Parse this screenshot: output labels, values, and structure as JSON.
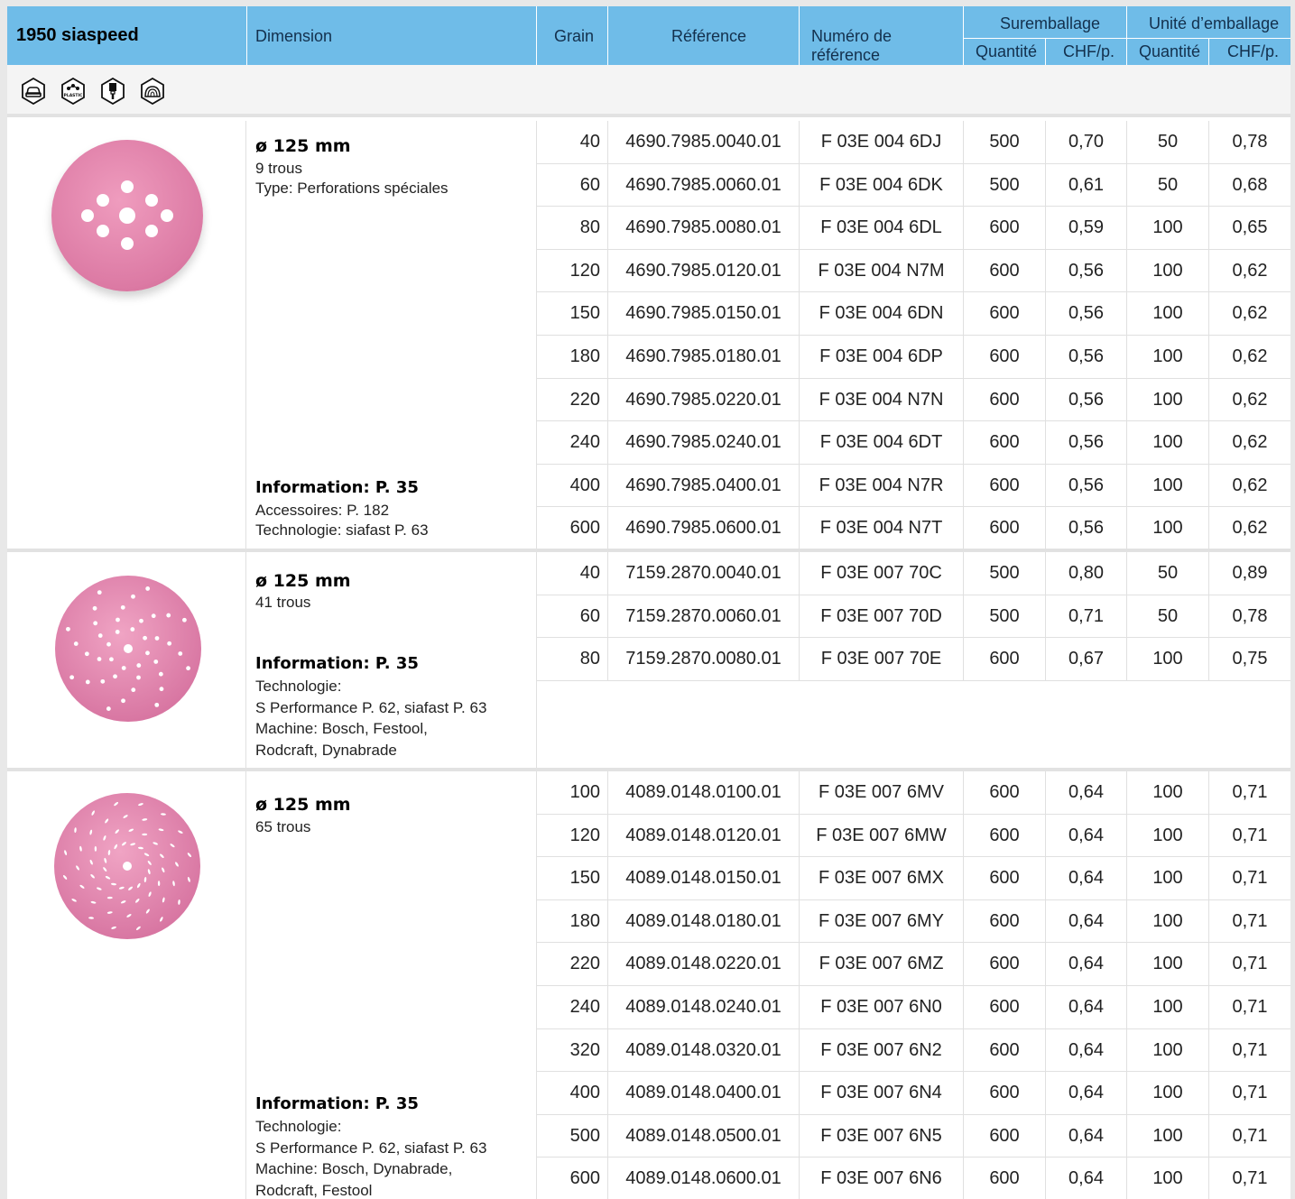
{
  "header": {
    "product": "1950 siaspeed",
    "dimension": "Dimension",
    "grain": "Grain",
    "reference": "Référence",
    "ref_number": "Numéro de référence",
    "overpack": "Suremballage",
    "unit_pack": "Unité d’emballage",
    "qty": "Quantité",
    "chf": "CHF/p."
  },
  "icons": [
    "car-body-icon",
    "plastic-icon",
    "paint-brush-icon",
    "wood-icon"
  ],
  "icon_plastic_text": "PLASTIC",
  "sections": [
    {
      "title": "ø 125 mm",
      "lines_top": "9 trous\nType: Perforations spéciales",
      "info": "Information: P. 35",
      "lines_bottom": "Accessoires: P. 182\nTechnologie: siafast P. 63",
      "rows": [
        [
          "40",
          "4690.7985.0040.01",
          "F 03E 004 6DJ",
          "500",
          "0,70",
          "50",
          "0,78"
        ],
        [
          "60",
          "4690.7985.0060.01",
          "F 03E 004 6DK",
          "500",
          "0,61",
          "50",
          "0,68"
        ],
        [
          "80",
          "4690.7985.0080.01",
          "F 03E 004 6DL",
          "600",
          "0,59",
          "100",
          "0,65"
        ],
        [
          "120",
          "4690.7985.0120.01",
          "F 03E 004 N7M",
          "600",
          "0,56",
          "100",
          "0,62"
        ],
        [
          "150",
          "4690.7985.0150.01",
          "F 03E 004 6DN",
          "600",
          "0,56",
          "100",
          "0,62"
        ],
        [
          "180",
          "4690.7985.0180.01",
          "F 03E 004 6DP",
          "600",
          "0,56",
          "100",
          "0,62"
        ],
        [
          "220",
          "4690.7985.0220.01",
          "F 03E 004 N7N",
          "600",
          "0,56",
          "100",
          "0,62"
        ],
        [
          "240",
          "4690.7985.0240.01",
          "F 03E 004 6DT",
          "600",
          "0,56",
          "100",
          "0,62"
        ],
        [
          "400",
          "4690.7985.0400.01",
          "F 03E 004 N7R",
          "600",
          "0,56",
          "100",
          "0,62"
        ],
        [
          "600",
          "4690.7985.0600.01",
          "F 03E 004 N7T",
          "600",
          "0,56",
          "100",
          "0,62"
        ]
      ]
    },
    {
      "title": "ø 125 mm",
      "lines_top": "41 trous",
      "info": "Information: P. 35",
      "lines_bottom": "Technologie:\nS Performance P. 62, siafast P. 63\nMachine: Bosch, Festool,\nRodcraft, Dynabrade",
      "rows": [
        [
          "40",
          "7159.2870.0040.01",
          "F 03E 007 70C",
          "500",
          "0,80",
          "50",
          "0,89"
        ],
        [
          "60",
          "7159.2870.0060.01",
          "F 03E 007 70D",
          "500",
          "0,71",
          "50",
          "0,78"
        ],
        [
          "80",
          "7159.2870.0080.01",
          "F 03E 007 70E",
          "600",
          "0,67",
          "100",
          "0,75"
        ]
      ]
    },
    {
      "title": "ø 125 mm",
      "lines_top": "65 trous",
      "info": "Information: P. 35",
      "lines_bottom": "Technologie:\nS Performance P. 62, siafast P. 63\nMachine: Bosch, Dynabrade,\nRodcraft, Festool",
      "rows": [
        [
          "100",
          "4089.0148.0100.01",
          "F 03E 007 6MV",
          "600",
          "0,64",
          "100",
          "0,71"
        ],
        [
          "120",
          "4089.0148.0120.01",
          "F 03E 007 6MW",
          "600",
          "0,64",
          "100",
          "0,71"
        ],
        [
          "150",
          "4089.0148.0150.01",
          "F 03E 007 6MX",
          "600",
          "0,64",
          "100",
          "0,71"
        ],
        [
          "180",
          "4089.0148.0180.01",
          "F 03E 007 6MY",
          "600",
          "0,64",
          "100",
          "0,71"
        ],
        [
          "220",
          "4089.0148.0220.01",
          "F 03E 007 6MZ",
          "600",
          "0,64",
          "100",
          "0,71"
        ],
        [
          "240",
          "4089.0148.0240.01",
          "F 03E 007 6N0",
          "600",
          "0,64",
          "100",
          "0,71"
        ],
        [
          "320",
          "4089.0148.0320.01",
          "F 03E 007 6N2",
          "600",
          "0,64",
          "100",
          "0,71"
        ],
        [
          "400",
          "4089.0148.0400.01",
          "F 03E 007 6N4",
          "600",
          "0,64",
          "100",
          "0,71"
        ],
        [
          "500",
          "4089.0148.0500.01",
          "F 03E 007 6N5",
          "600",
          "0,64",
          "100",
          "0,71"
        ],
        [
          "600",
          "4089.0148.0600.01",
          "F 03E 007 6N6",
          "600",
          "0,64",
          "100",
          "0,71"
        ]
      ]
    }
  ],
  "colors": {
    "header_bg": "#6fbce8",
    "disc": "#e07fa8"
  }
}
